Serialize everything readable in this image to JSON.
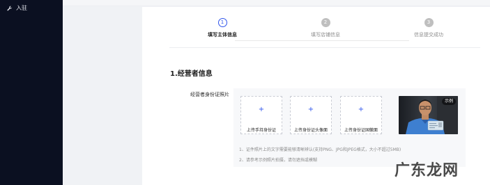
{
  "sidebar": {
    "items": [
      {
        "label": "入驻",
        "icon": "wrench-icon"
      }
    ]
  },
  "steps": [
    {
      "number": "1",
      "label": "填写主体信息",
      "state": "active"
    },
    {
      "number": "2",
      "label": "填写店铺信息",
      "state": "inactive"
    },
    {
      "number": "3",
      "label": "信息提交成功",
      "state": "inactive"
    }
  ],
  "section": {
    "title": "1.经营者信息"
  },
  "id_photo": {
    "label": "经营者身份证照片",
    "upload_cards": [
      {
        "plus": "+",
        "label": "上传手持身份证"
      },
      {
        "plus": "+",
        "label": "上传身份证头像面"
      },
      {
        "plus": "+",
        "label": "上传身份证国徽面"
      }
    ],
    "sample_badge": "示例",
    "notes": [
      "1、证件照片上的文字需要能够清晰辨认(支持PNG、JPG和JPEG格式，大小不超过5MB)",
      "2、请参考示例照片拍摄，请勿遮挡或模糊"
    ]
  },
  "watermark": {
    "text": "广东龙网"
  },
  "colors": {
    "sidebar_bg": "#0b1021",
    "accent": "#2f54eb",
    "inactive_step": "#bfbfbf",
    "upload_area_bg": "#f7f8fa"
  }
}
